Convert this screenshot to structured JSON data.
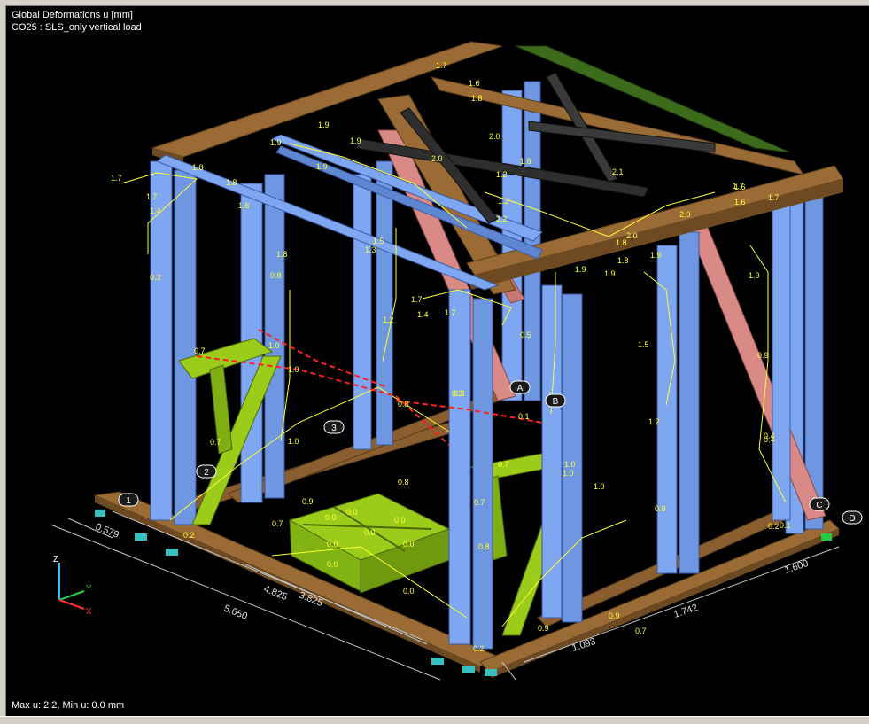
{
  "viewport": {
    "title_line1": "Global Deformations u [mm]",
    "title_line2": "CO25 : SLS_only vertical load",
    "footer": "Max u: 2.2, Min u: 0.0 mm"
  },
  "colors": {
    "background": "#000000",
    "column_blue": "#7fa6f0",
    "girder_brown": "#9b6b35",
    "green_frame": "#9ccc1a",
    "roof_green": "#3d6b1c",
    "brace_pink": "#d98a86",
    "brace_dark": "#2e2e2e",
    "deformation_yellow": "#ffff33",
    "dimension_gray": "#c8c8c8"
  },
  "axis_triad": {
    "z": "Z",
    "y": "Y",
    "x": "X"
  },
  "grid_markers": [
    "1",
    "2",
    "3",
    "A",
    "B",
    "C",
    "D"
  ],
  "dimensions": [
    "0.579",
    "5.650",
    "4.825",
    "3.825",
    "1.093",
    "1.742",
    "1.600"
  ],
  "deformation_labels": [
    "1.7",
    "1.7",
    "1.6",
    "1.8",
    "1.9",
    "1.9",
    "1.9",
    "2.0",
    "2.0",
    "2.1",
    "1.8",
    "1.8",
    "1.6",
    "1.7",
    "1.7",
    "1.4",
    "1.9",
    "1.5",
    "1.6",
    "1.2",
    "2.2",
    "1.3",
    "1.8",
    "1.8",
    "0.8",
    "0.3",
    "1.7",
    "1.4",
    "1.7",
    "1.2",
    "1.9",
    "1.9",
    "1.8",
    "1.8",
    "1.9",
    "1.9",
    "2.0",
    "2.0",
    "1.6",
    "1.7",
    "1.2",
    "1.5",
    "1.2",
    "0.9",
    "0.9",
    "0.4",
    "0.7",
    "1.0",
    "1.0",
    "0.7",
    "0.8",
    "1.0",
    "0.3",
    "0.1",
    "0.8",
    "1.0",
    "1.0",
    "0.9",
    "0.7",
    "0.2",
    "0.0",
    "0.0",
    "0.0",
    "0.0",
    "0.0",
    "0.0",
    "0.0",
    "0.0",
    "0.7",
    "0.8",
    "0.9",
    "0.9",
    "0.7",
    "0.2",
    "0.1",
    "0.4",
    "0.5",
    "0.3",
    "0.2",
    "0.7",
    "1.0"
  ]
}
